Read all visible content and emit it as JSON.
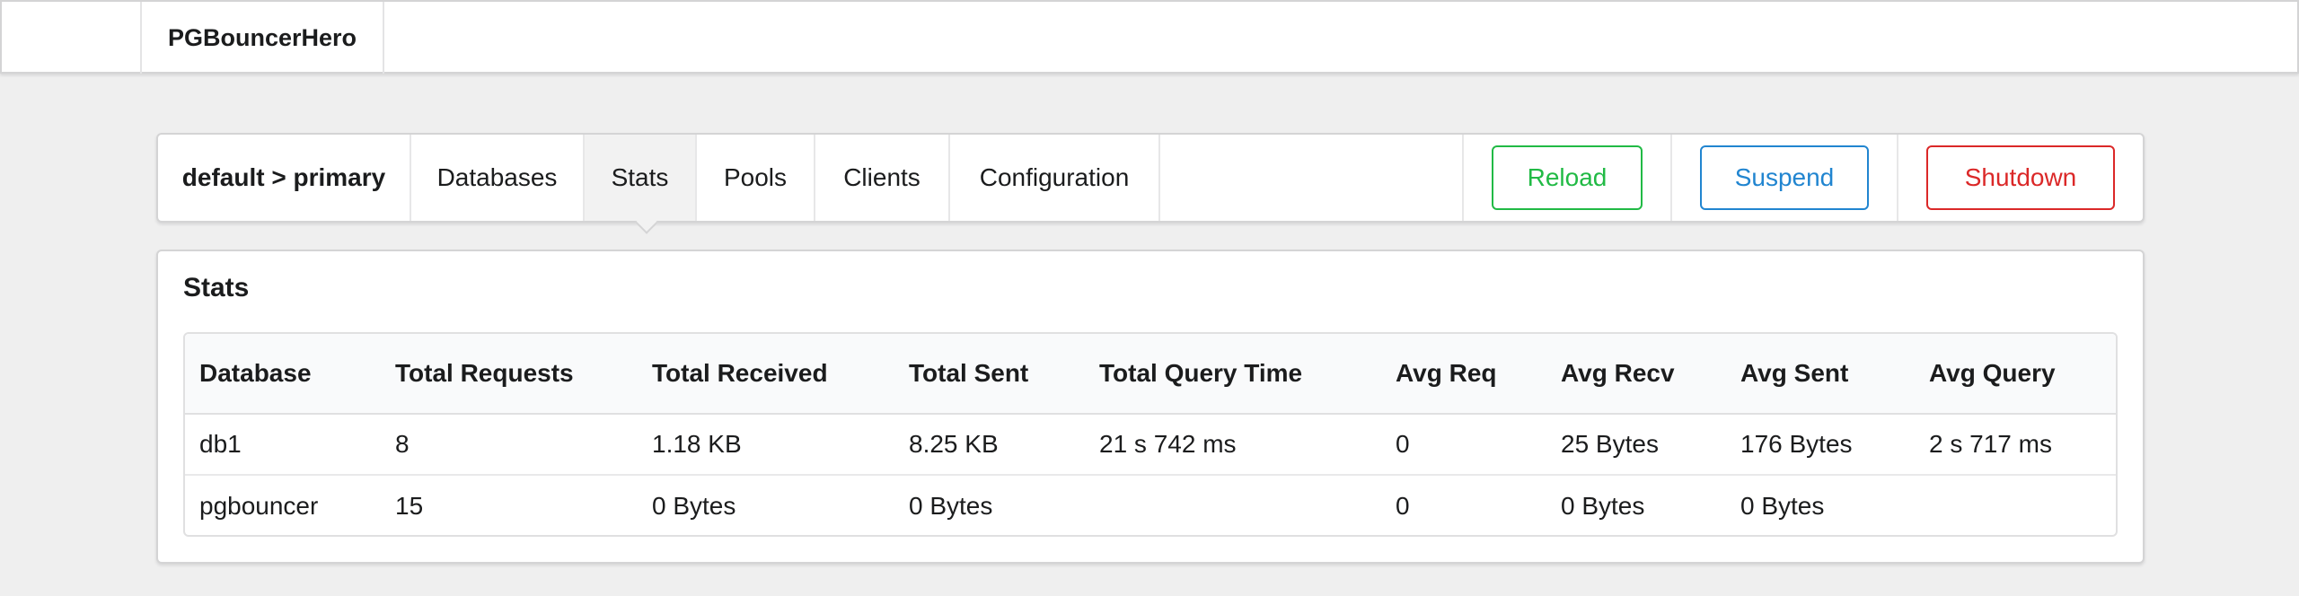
{
  "app": {
    "brand": "PGBouncerHero"
  },
  "menu": {
    "breadcrumb": "default > primary",
    "tabs": [
      {
        "label": "Databases",
        "active": false
      },
      {
        "label": "Stats",
        "active": true
      },
      {
        "label": "Pools",
        "active": false
      },
      {
        "label": "Clients",
        "active": false
      },
      {
        "label": "Configuration",
        "active": false
      }
    ],
    "actions": {
      "reload": "Reload",
      "suspend": "Suspend",
      "shutdown": "Shutdown"
    }
  },
  "stats": {
    "title": "Stats",
    "columns": [
      "Database",
      "Total Requests",
      "Total Received",
      "Total Sent",
      "Total Query Time",
      "Avg Req",
      "Avg Recv",
      "Avg Sent",
      "Avg Query"
    ],
    "rows": [
      [
        "db1",
        "8",
        "1.18 KB",
        "8.25 KB",
        "21 s 742 ms",
        "0",
        "25 Bytes",
        "176 Bytes",
        "2 s 717 ms"
      ],
      [
        "pgbouncer",
        "15",
        "0 Bytes",
        "0 Bytes",
        "",
        "0",
        "0 Bytes",
        "0 Bytes",
        ""
      ]
    ]
  },
  "colors": {
    "reload": "#21ba45",
    "suspend": "#2185d0",
    "shutdown": "#db2828"
  }
}
